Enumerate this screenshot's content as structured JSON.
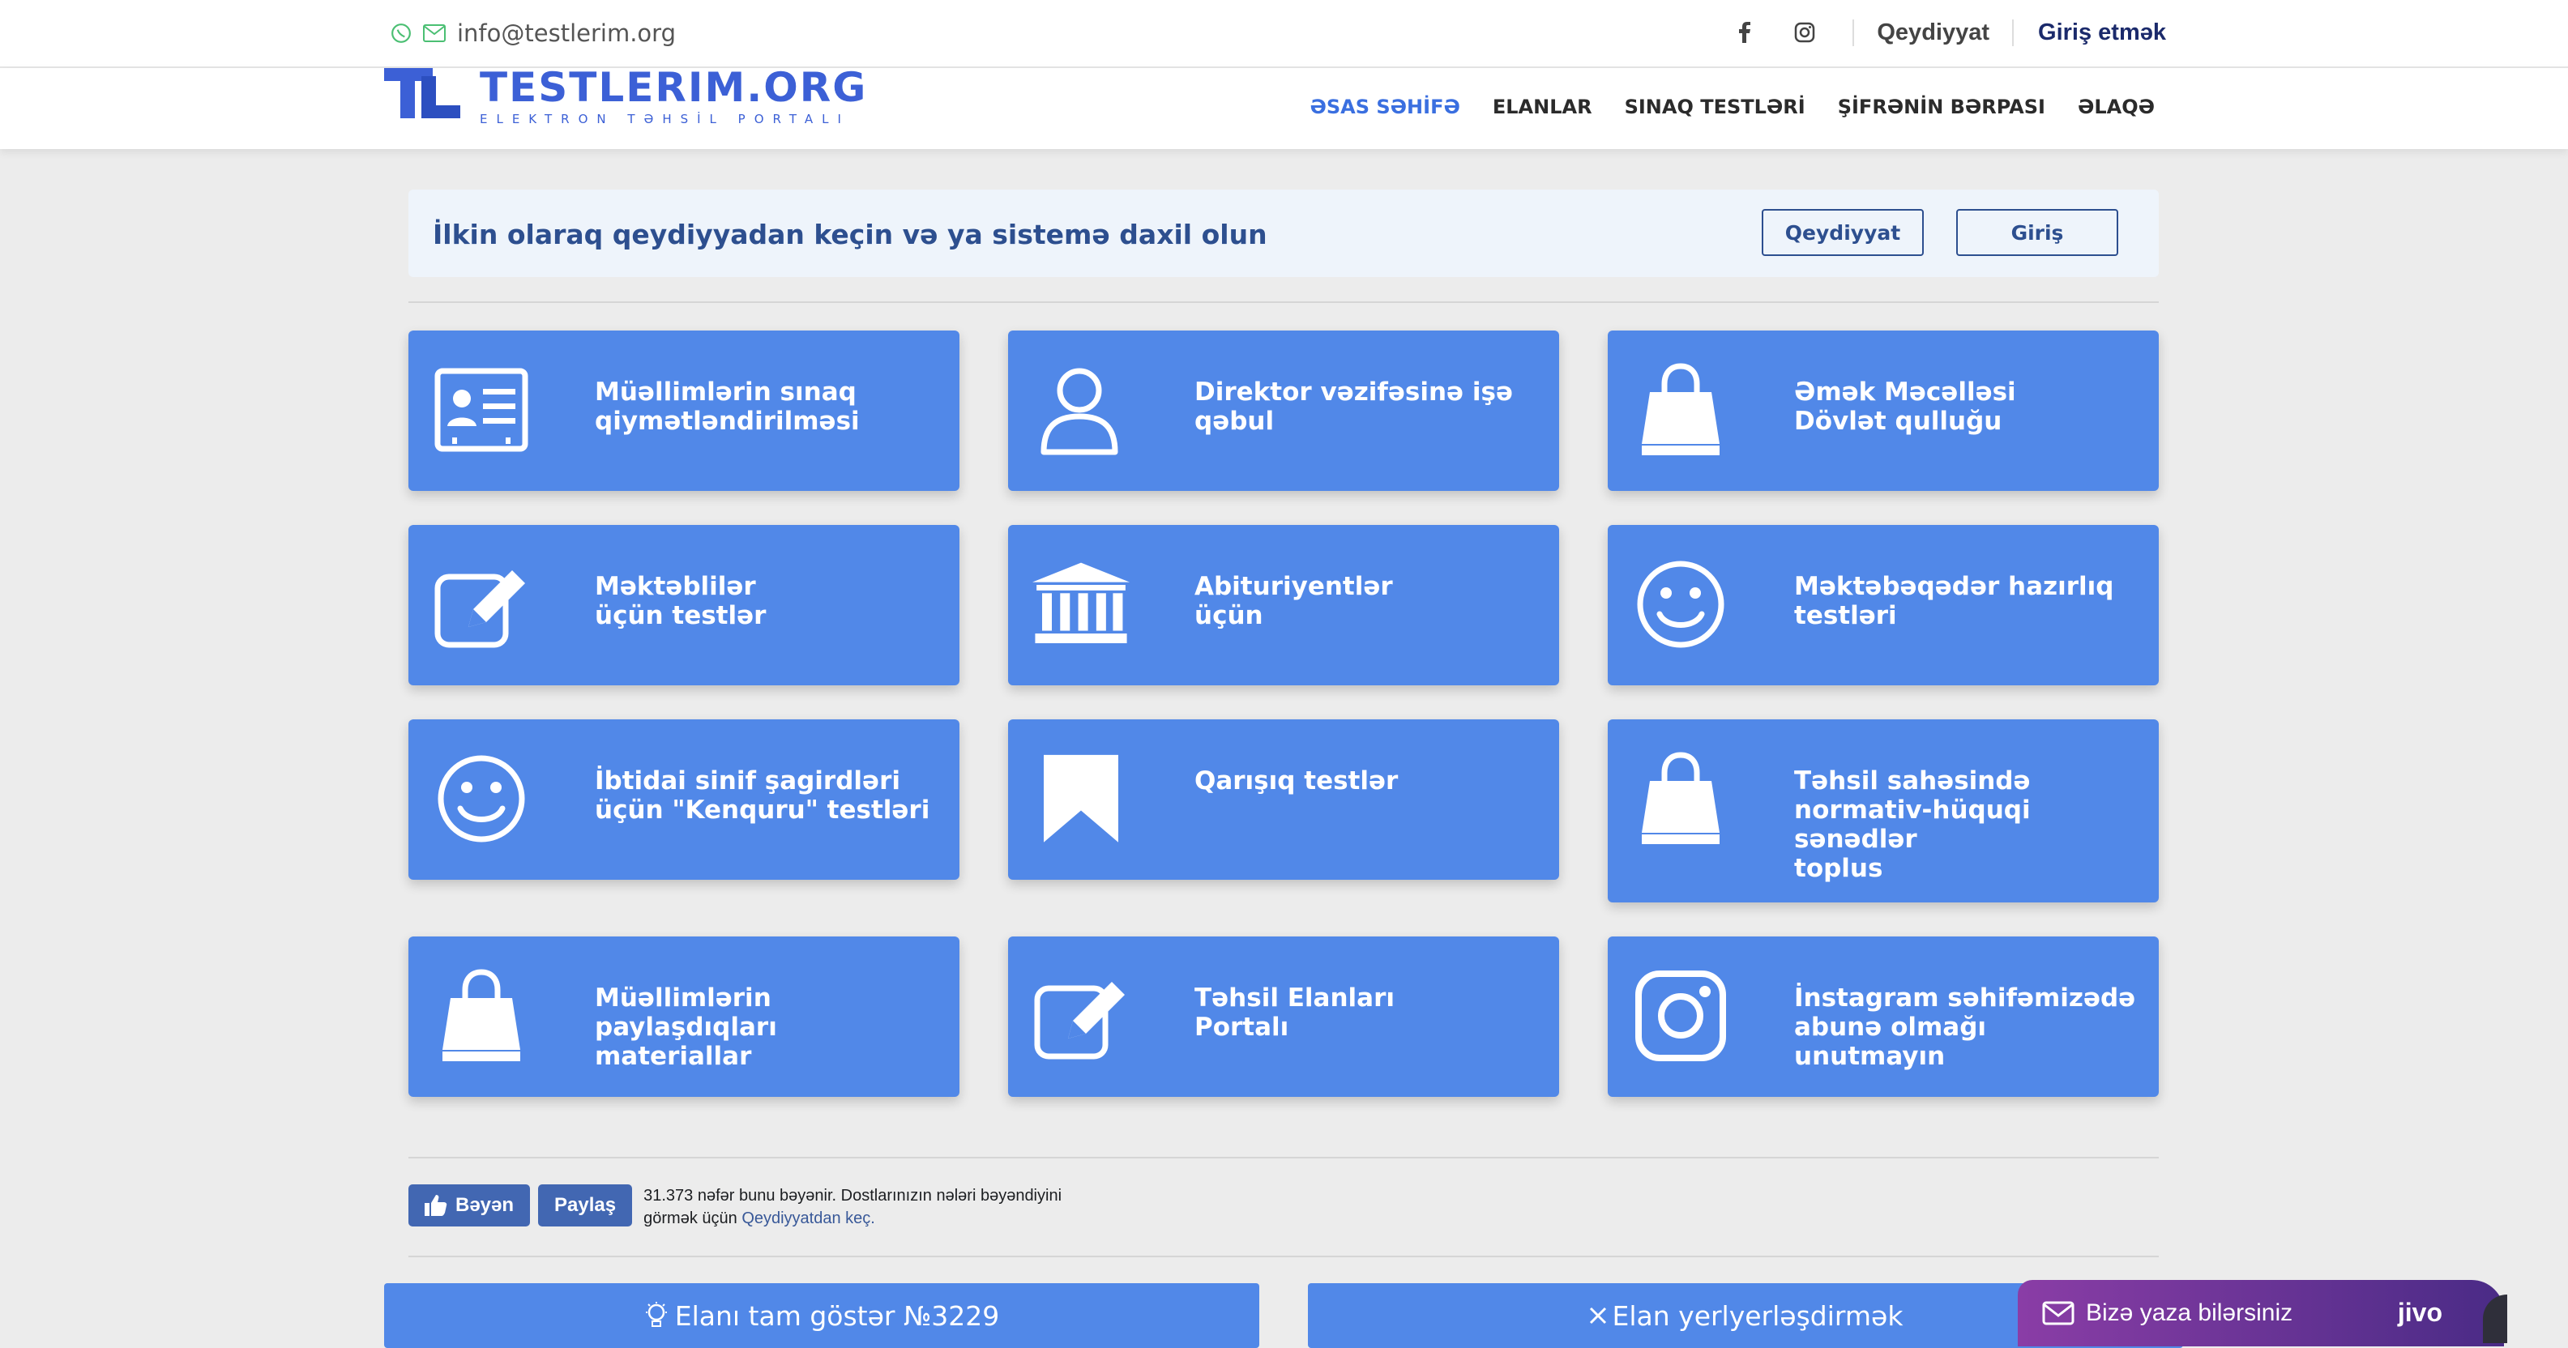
{
  "topbar": {
    "email": "info@testlerim.org",
    "register": "Qeydiyyat",
    "login": "Giriş etmək"
  },
  "logo": {
    "title": "TESTLERIM.ORG",
    "subtitle": "ELEKTRON TƏHSİL PORTALI"
  },
  "nav": [
    "ƏSAS SƏHİFƏ",
    "ELANLAR",
    "SINAQ TESTLƏRİ",
    "ŞİFRƏNİN BƏRPASI",
    "ƏLAQƏ"
  ],
  "banner": {
    "text": "İlkin olaraq qeydiyyadan keçin və ya sistemə daxil olun",
    "register_btn": "Qeydiyyat",
    "login_btn": "Giriş"
  },
  "cards": [
    {
      "label": "Müəllimlərin sınaq\nqiymətləndirilməsi",
      "icon": "id-card-icon"
    },
    {
      "label": "Direktor vəzifəsinə işə\nqəbul",
      "icon": "user-icon"
    },
    {
      "label": "Əmək Məcəlləsi\nDövlət qulluğu",
      "icon": "shopping-bag-icon"
    },
    {
      "label": "Məktəblilər\nüçün testlər",
      "icon": "edit-icon"
    },
    {
      "label": "Abituriyentlər\nüçün",
      "icon": "university-icon"
    },
    {
      "label": "Məktəbəqədər hazırlıq\ntestləri",
      "icon": "smile-icon"
    },
    {
      "label": "İbtidai sinif şagirdləri\nüçün \"Kenquru\" testləri",
      "icon": "smile-icon"
    },
    {
      "label": "Qarışıq testlər",
      "icon": "bookmark-icon"
    },
    {
      "label": "Təhsil sahəsində\nnormativ-hüquqi sənədlər\ntoplus",
      "icon": "shopping-bag-icon"
    },
    {
      "label": "Müəllimlərin paylaşdıqları\nmateriallar",
      "icon": "shopping-bag-icon"
    },
    {
      "label": "Təhsil Elanları\nPortalı",
      "icon": "edit-icon"
    },
    {
      "label": "İnstagram səhifəmizədə\nabunə olmağı unutmayın",
      "icon": "instagram-icon"
    }
  ],
  "facebook": {
    "like": "Bəyən",
    "share": "Paylaş",
    "text": "31.373 nəfər bunu bəyənir. Dostlarınızın nələri bəyəndiyini görmək üçün",
    "link": "Qeydiyyatdan keç."
  },
  "bottom": {
    "show_ad": "Elanı tam göstər №3229",
    "place_ad": "Elan yerlyerləşdirmək"
  },
  "chat": {
    "message": "Bizə yaza bilərsiniz",
    "brand": "jivo"
  },
  "colors": {
    "card": "#5188e8",
    "accent": "#3a6fe0",
    "banner_bg": "#eef4fb"
  }
}
